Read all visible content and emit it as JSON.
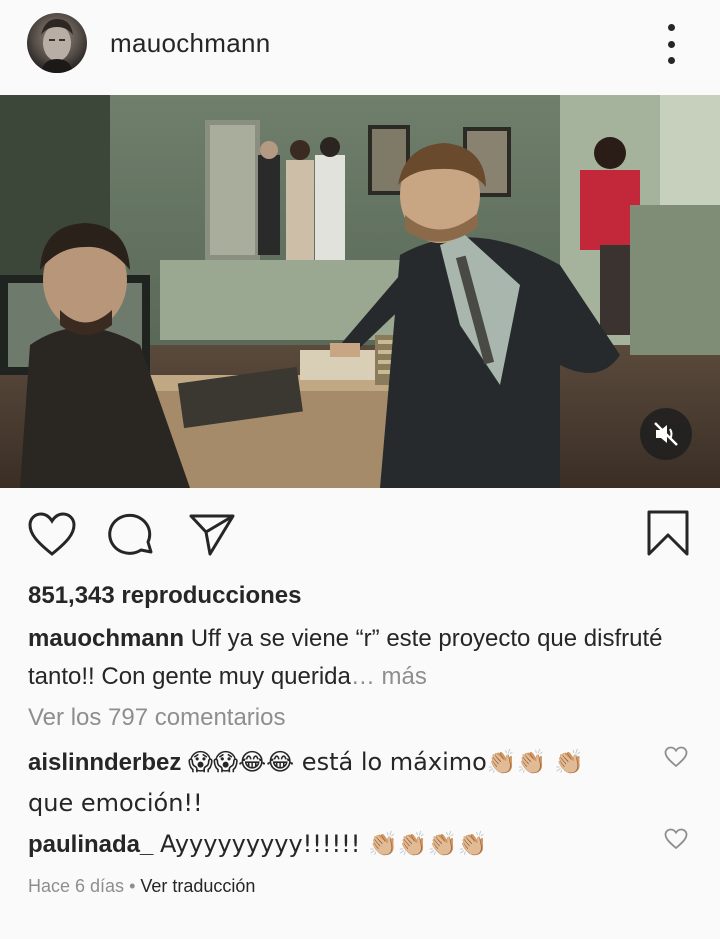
{
  "header": {
    "username": "mauochmann",
    "more_icon": "more-vertical-icon"
  },
  "media": {
    "type": "video",
    "description_icon": "video-frame",
    "mute_icon": "muted-speaker-icon"
  },
  "actions": {
    "like_icon": "heart-icon",
    "comment_icon": "comment-bubble-icon",
    "share_icon": "paper-plane-icon",
    "save_icon": "bookmark-icon"
  },
  "stats": {
    "views": "851,343 reproducciones"
  },
  "caption": {
    "username": "mauochmann",
    "text": "Uff ya se viene “r” este proyecto que disfruté tanto!! Con gente muy querida",
    "ellipsis": "… ",
    "more": "más"
  },
  "view_comments": "Ver los 797 comentarios",
  "comments": [
    {
      "username": "aislinnderbez",
      "text": "😱😱😂😂 está lo máximo👏🏼👏🏼 👏🏼 que emoción!!"
    },
    {
      "username": "paulinada_",
      "text": "Ayyyyyyyyy!!!!!! 👏🏼👏🏼👏🏼👏🏼"
    }
  ],
  "meta": {
    "time": "Hace 6 días",
    "separator": " • ",
    "translate": "Ver traducción"
  },
  "colors": {
    "text": "#262626",
    "secondary": "#8e8e8e",
    "background": "#fafafa"
  }
}
